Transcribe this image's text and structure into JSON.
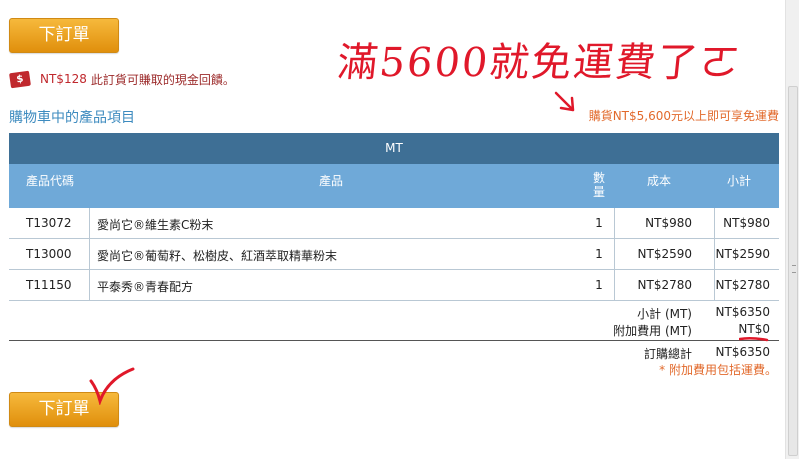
{
  "buttons": {
    "place_order": "下訂單"
  },
  "cashback": {
    "icon": "$",
    "amount": "NT$128",
    "text": "此訂貨可賺取的現金回饋。"
  },
  "annotation": {
    "handwriting": "滿5600就免運費了ㄛ"
  },
  "cart": {
    "title": "購物車中的產品項目",
    "free_shipping_notice": "購貨NT$5,600元以上即可享免運費",
    "brand": "MT",
    "headers": {
      "code": "產品代碼",
      "product": "產品",
      "quantity_line1": "數",
      "quantity_line2": "量",
      "cost": "成本",
      "subtotal": "小計"
    },
    "items": [
      {
        "code": "T13072",
        "name": "愛尚它®維生素C粉末",
        "qty": "1",
        "cost": "NT$980",
        "subtotal": "NT$980"
      },
      {
        "code": "T13000",
        "name": "愛尚它®葡萄籽、松樹皮、紅酒萃取精華粉末",
        "qty": "1",
        "cost": "NT$2590",
        "subtotal": "NT$2590"
      },
      {
        "code": "T11150",
        "name": "平泰秀®青春配方",
        "qty": "1",
        "cost": "NT$2780",
        "subtotal": "NT$2780"
      }
    ],
    "subtotal_label": "小計 (MT)",
    "subtotal_value": "NT$6350",
    "surcharge_label": "附加費用 (MT)",
    "surcharge_value": "NT$0",
    "grand_total_label": "訂購總計",
    "grand_total_value": "NT$6350",
    "surcharge_note": "* 附加費用包括運費。"
  }
}
